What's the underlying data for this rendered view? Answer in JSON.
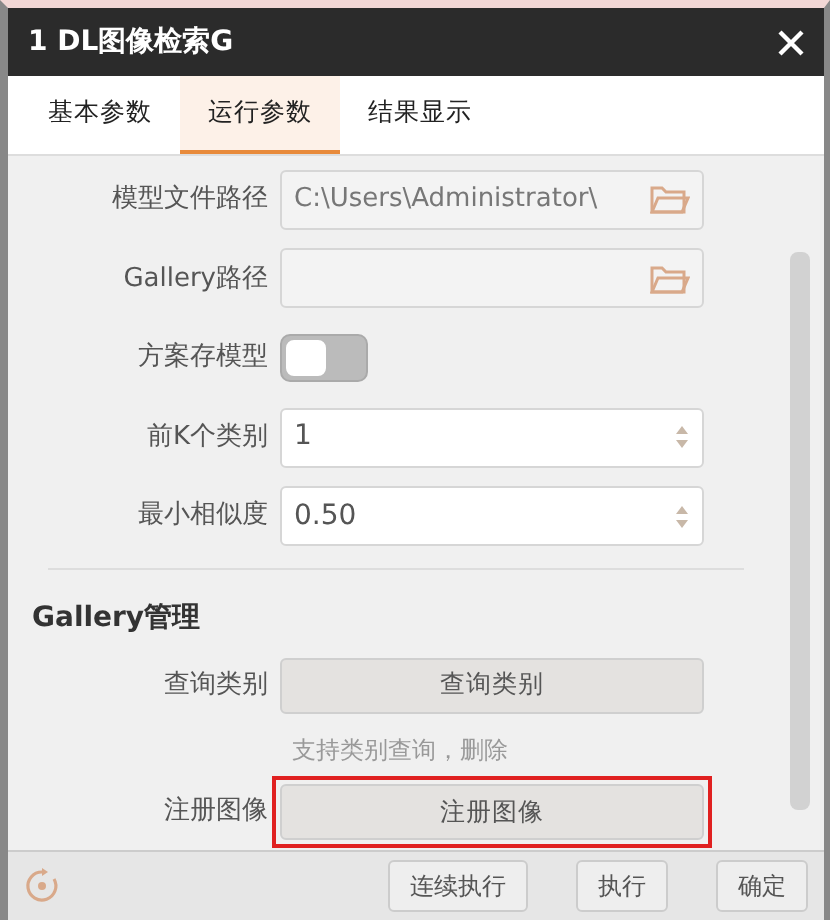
{
  "window": {
    "title": "1 DL图像检索G"
  },
  "tabs": [
    {
      "label": "基本参数",
      "selected": false
    },
    {
      "label": "运行参数",
      "selected": true
    },
    {
      "label": "结果显示",
      "selected": false
    }
  ],
  "params": [
    {
      "kind": "path",
      "label": "模型文件路径",
      "value": "C:\\Users\\Administrator\\"
    },
    {
      "kind": "path",
      "label": "Gallery路径"
    },
    {
      "kind": "toggle",
      "label": "方案存模型",
      "on": false
    },
    {
      "kind": "spinner",
      "label": "前K个类别",
      "value": "1"
    },
    {
      "kind": "spinner",
      "label": "最小相似度",
      "value": "0.50"
    }
  ],
  "section": {
    "title": "Gallery管理",
    "rows": [
      {
        "kind": "button",
        "label": "查询类别",
        "button": "查询类别"
      },
      {
        "kind": "hint",
        "text": "支持类别查询，删除"
      },
      {
        "kind": "button",
        "label": "注册图像",
        "button": "注册图像",
        "highlighted": true
      }
    ]
  },
  "footer_buttons": [
    "连续执行",
    "执行",
    "确定"
  ]
}
